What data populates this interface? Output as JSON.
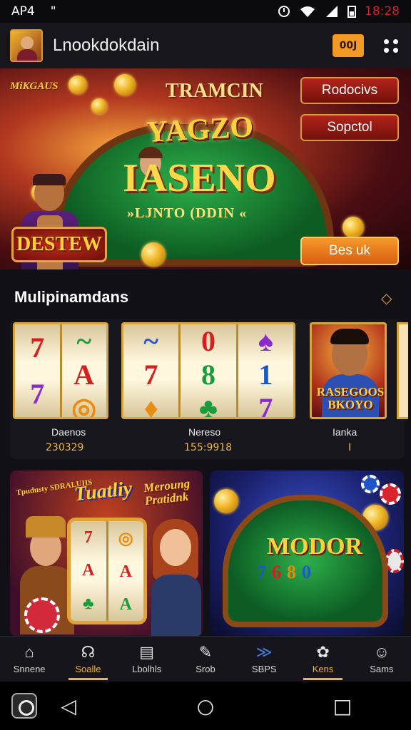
{
  "status": {
    "carrier": "AP4",
    "left_glyph": "\"",
    "time": "18:28"
  },
  "header": {
    "title": "Lnookdokdain",
    "coin_button": "00J"
  },
  "hero": {
    "badge": "MiKGAUS",
    "top_text": "TRAMCIN",
    "title_line1": "YAGZO",
    "title_line2": "IASENO",
    "subtitle": "»LJNTO (DDIN «",
    "logo": "DESTEW",
    "button_1": "Rodocivs",
    "button_2": "Sopctol",
    "cta": "Bes uk"
  },
  "section": {
    "title": "Mulipinamdans",
    "chevron": "◇"
  },
  "slots": [
    {
      "name": "Daenos",
      "value": "230329"
    },
    {
      "name": "Nereso",
      "value": "155:9918"
    },
    {
      "name": "Ianka",
      "value": "I",
      "portrait_label": "RASEGOOS BKOYO"
    }
  ],
  "cards": {
    "card1_main": "Tuatliy",
    "card1_left": "Tpudusty SDRALUIIS",
    "card1_right": "Meroung Pratidnk",
    "card2_title": "MODOR",
    "card2_numbers": [
      "7",
      "6",
      "8",
      "0"
    ]
  },
  "tabs": [
    {
      "label": "Snnene",
      "icon": "home-icon"
    },
    {
      "label": "Soalle",
      "icon": "headset-icon",
      "active": true
    },
    {
      "label": "Lbolhls",
      "icon": "cards-icon"
    },
    {
      "label": "Srob",
      "icon": "rocket-icon"
    },
    {
      "label": "SBPS",
      "icon": "bird-icon"
    },
    {
      "label": "Kens",
      "icon": "gift-icon",
      "active": true
    },
    {
      "label": "Sams",
      "icon": "profile-icon"
    }
  ],
  "colors": {
    "accent": "#f0b43a",
    "cta": "#f29a24",
    "dark": "#101016"
  }
}
